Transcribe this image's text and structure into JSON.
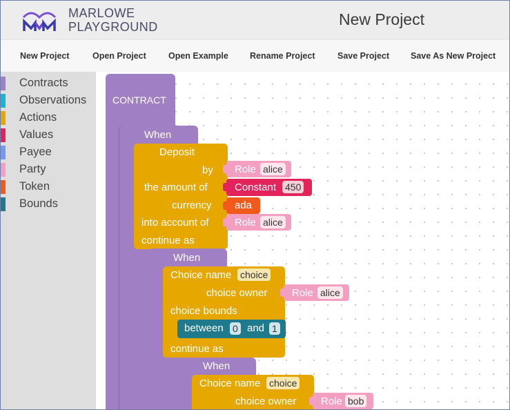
{
  "brand": {
    "line1": "MARLOWE",
    "line2": "PLAYGROUND",
    "logo_icon": "marlowe-logo-icon"
  },
  "page_title": "New Project",
  "toolbar": {
    "new_project": "New Project",
    "open_project": "Open Project",
    "open_example": "Open Example",
    "rename_project": "Rename Project",
    "save_project": "Save Project",
    "save_as_new_project": "Save As New Project"
  },
  "categories": [
    {
      "label": "Contracts",
      "color": "#a17fc4"
    },
    {
      "label": "Observations",
      "color": "#16b8cf"
    },
    {
      "label": "Actions",
      "color": "#e6a800"
    },
    {
      "label": "Values",
      "color": "#e3245a"
    },
    {
      "label": "Payee",
      "color": "#7399f5"
    },
    {
      "label": "Party",
      "color": "#f29fc2"
    },
    {
      "label": "Token",
      "color": "#f05a1c"
    },
    {
      "label": "Bounds",
      "color": "#1f7a8c"
    }
  ],
  "blocks": {
    "contract": "CONTRACT",
    "when1": "When",
    "deposit": {
      "title": "Deposit",
      "by": "by",
      "the_amount_of": "the amount of",
      "currency": "currency",
      "into_account_of": "into account of",
      "continue_as": "continue as",
      "by_role": "Role",
      "by_role_name": "alice",
      "amount_type": "Constant",
      "amount_value": "450",
      "currency_value": "ada",
      "account_role": "Role",
      "account_role_name": "alice"
    },
    "when2": "When",
    "choice1": {
      "choice_name": "Choice name",
      "choice_name_value": "choice",
      "choice_owner": "choice owner",
      "owner_role": "Role",
      "owner_role_name": "alice",
      "choice_bounds": "choice bounds",
      "between": "between",
      "low": "0",
      "and": "and",
      "high": "1",
      "continue_as": "continue as"
    },
    "when3": "When",
    "choice2": {
      "choice_name": "Choice name",
      "choice_name_value": "choice",
      "choice_owner": "choice owner",
      "owner_role": "Role",
      "owner_role_name": "bob"
    }
  }
}
